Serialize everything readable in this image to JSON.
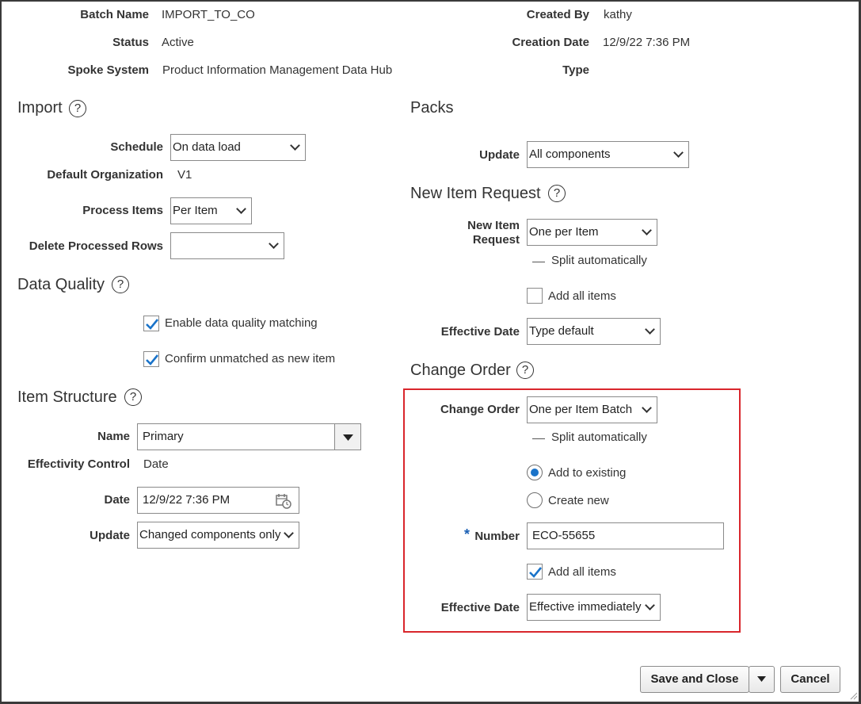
{
  "header": {
    "batch_name_label": "Batch Name",
    "batch_name_value": "IMPORT_TO_CO",
    "status_label": "Status",
    "status_value": "Active",
    "spoke_label": "Spoke System",
    "spoke_value": "Product Information Management Data Hub",
    "created_by_label": "Created By",
    "created_by_value": "kathy",
    "creation_date_label": "Creation Date",
    "creation_date_value": "12/9/22 7:36 PM",
    "type_label": "Type"
  },
  "import": {
    "title": "Import",
    "schedule_label": "Schedule",
    "schedule_value": "On data load",
    "default_org_label": "Default Organization",
    "default_org_value": "V1",
    "process_items_label": "Process Items",
    "process_items_value": "Per Item",
    "delete_rows_label": "Delete Processed Rows",
    "delete_rows_value": ""
  },
  "data_quality": {
    "title": "Data Quality",
    "enable_matching_label": "Enable data quality matching",
    "enable_matching_checked": true,
    "confirm_unmatched_label": "Confirm unmatched as new item",
    "confirm_unmatched_checked": true
  },
  "item_structure": {
    "title": "Item Structure",
    "name_label": "Name",
    "name_value": "Primary",
    "effectivity_label": "Effectivity Control",
    "effectivity_value": "Date",
    "date_label": "Date",
    "date_value": "12/9/22 7:36 PM",
    "update_label": "Update",
    "update_value": "Changed components only"
  },
  "packs": {
    "title": "Packs",
    "update_label": "Update",
    "update_value": "All components"
  },
  "new_item_request": {
    "title": "New Item Request",
    "nir_label_line1": "New Item",
    "nir_label_line2": "Request",
    "nir_value": "One per Item",
    "split_label": "Split automatically",
    "add_all_label": "Add all items",
    "add_all_checked": false,
    "effective_date_label": "Effective Date",
    "effective_date_value": "Type default"
  },
  "change_order": {
    "title": "Change Order",
    "co_label": "Change Order",
    "co_value": "One per Item Batch",
    "split_label": "Split automatically",
    "add_existing_label": "Add to existing",
    "create_new_label": "Create new",
    "selected_option": "Add to existing",
    "required_marker": "*",
    "number_label": "Number",
    "number_value": "ECO-55655",
    "add_all_label": "Add all items",
    "add_all_checked": true,
    "effective_date_label": "Effective Date",
    "effective_date_value": "Effective immediately",
    "highlight_color": "#d9262c"
  },
  "footer": {
    "save_close_label": "Save and Close",
    "cancel_label": "Cancel"
  },
  "colors": {
    "accent": "#1a73c9",
    "text": "#333333"
  }
}
